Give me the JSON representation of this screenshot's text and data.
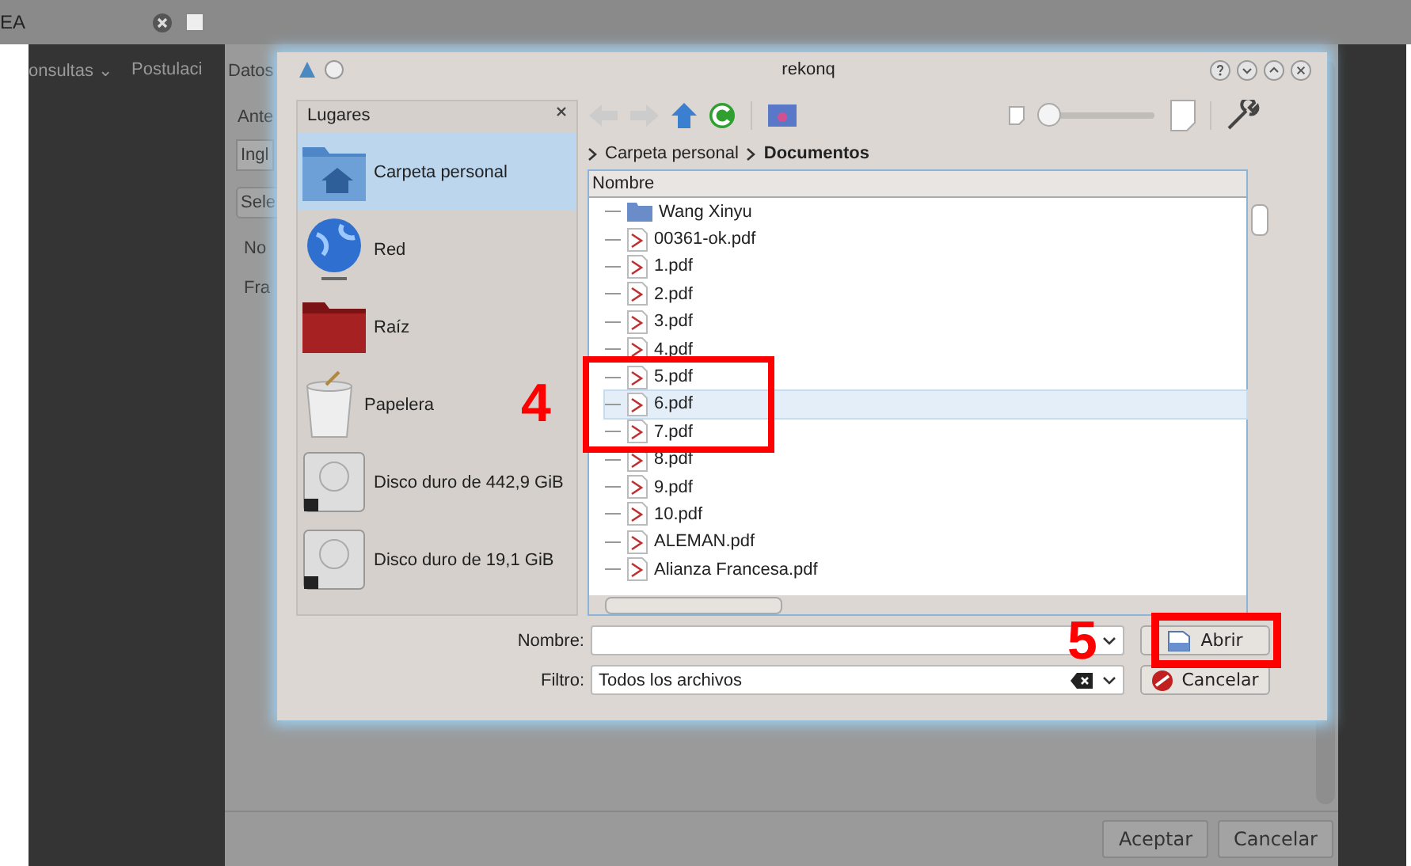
{
  "browser_tab": {
    "title": "EA"
  },
  "background_nav": [
    "onsultas ⌄",
    "Postulaci"
  ],
  "background_dialog": {
    "title": "Datos",
    "label": "Ante",
    "field_value": "Ingl",
    "button": "Sele",
    "table_header": "No",
    "table_cell": "Fra",
    "buttons": [
      "Aceptar",
      "Cancelar"
    ]
  },
  "file_dialog": {
    "title": "rekonq",
    "places": {
      "title": "Lugares",
      "items": [
        {
          "label": "Carpeta personal",
          "kind": "home",
          "selected": true
        },
        {
          "label": "Red",
          "kind": "network",
          "selected": false
        },
        {
          "label": "Raíz",
          "kind": "root",
          "selected": false
        },
        {
          "label": "Papelera",
          "kind": "trash",
          "selected": false
        },
        {
          "label": "Disco duro de 442,9 GiB",
          "kind": "disk",
          "selected": false
        },
        {
          "label": "Disco duro de 19,1 GiB",
          "kind": "disk",
          "selected": false
        }
      ]
    },
    "zoom_slider": {
      "level": 0.05
    },
    "breadcrumb": [
      "Carpeta personal",
      "Documentos"
    ],
    "column": "Nombre",
    "files": [
      {
        "name": "Wang Xinyu",
        "kind": "folder",
        "selected": false
      },
      {
        "name": "00361-ok.pdf",
        "kind": "pdf",
        "selected": false
      },
      {
        "name": "1.pdf",
        "kind": "pdf",
        "selected": false
      },
      {
        "name": "2.pdf",
        "kind": "pdf",
        "selected": false
      },
      {
        "name": "3.pdf",
        "kind": "pdf",
        "selected": false
      },
      {
        "name": "4.pdf",
        "kind": "pdf",
        "selected": false
      },
      {
        "name": "5.pdf",
        "kind": "pdf",
        "selected": false
      },
      {
        "name": "6.pdf",
        "kind": "pdf",
        "selected": true
      },
      {
        "name": "7.pdf",
        "kind": "pdf",
        "selected": false
      },
      {
        "name": "8.pdf",
        "kind": "pdf",
        "selected": false
      },
      {
        "name": "9.pdf",
        "kind": "pdf",
        "selected": false
      },
      {
        "name": "10.pdf",
        "kind": "pdf",
        "selected": false
      },
      {
        "name": "ALEMAN.pdf",
        "kind": "pdf",
        "selected": false
      },
      {
        "name": "Alianza Francesa.pdf",
        "kind": "pdf",
        "selected": false
      }
    ],
    "name_label": "Nombre:",
    "filter_label": "Filtro:",
    "filter_value": "Todos los archivos",
    "open_button": "Abrir",
    "cancel_button": "Cancelar"
  },
  "annotations": [
    "4",
    "5"
  ]
}
